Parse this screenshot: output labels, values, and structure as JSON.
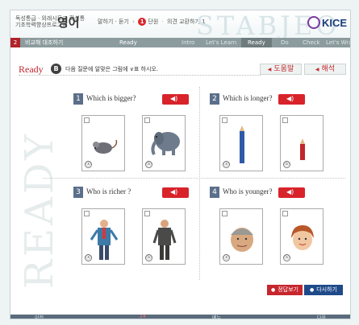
{
  "header": {
    "small_line1": "독성통급 · 외래시도교 확성통",
    "small_line2": "기초학력향상프로그램",
    "big_label": "영어",
    "crumb_1": "말하기 · 듣기",
    "crumb_2": "단원",
    "crumb_3": "의견 교환하기 1",
    "step_no": "1",
    "deco": "STABJEO",
    "logo": "KICE"
  },
  "nav": {
    "num": "2",
    "title": "비교해 대조하기",
    "items": [
      "Ready",
      "Intro",
      "Let's Learn",
      "Ready",
      "Do",
      "Check",
      "Let's Wrap it Up"
    ]
  },
  "sidebar_word": "READY",
  "instruction": {
    "ready": "Ready",
    "badge": "B",
    "text": "다음 질문에 알맞은 그림에 ∨표 하시오.",
    "help": "도움말",
    "answer": "해석"
  },
  "questions": [
    {
      "num": "1",
      "text": "Which is bigger?",
      "options": [
        "ⓐ",
        "ⓑ"
      ]
    },
    {
      "num": "2",
      "text": "Which is longer?",
      "options": [
        "ⓐ",
        "ⓑ"
      ]
    },
    {
      "num": "3",
      "text": "Who is richer ?",
      "options": [
        "ⓐ",
        "ⓑ"
      ]
    },
    {
      "num": "4",
      "text": "Who is younger?",
      "options": [
        "ⓐ",
        "ⓑ"
      ]
    }
  ],
  "buttons": {
    "view_answer": "정답보기",
    "retry": "다시하기"
  },
  "footer": [
    "이전",
    "24",
    "메뉴",
    "다음"
  ],
  "colors": {
    "accent": "#d8232a",
    "nav": "#8c9b9e",
    "qnum": "#5b6f8a",
    "retry": "#1f4a8a"
  }
}
